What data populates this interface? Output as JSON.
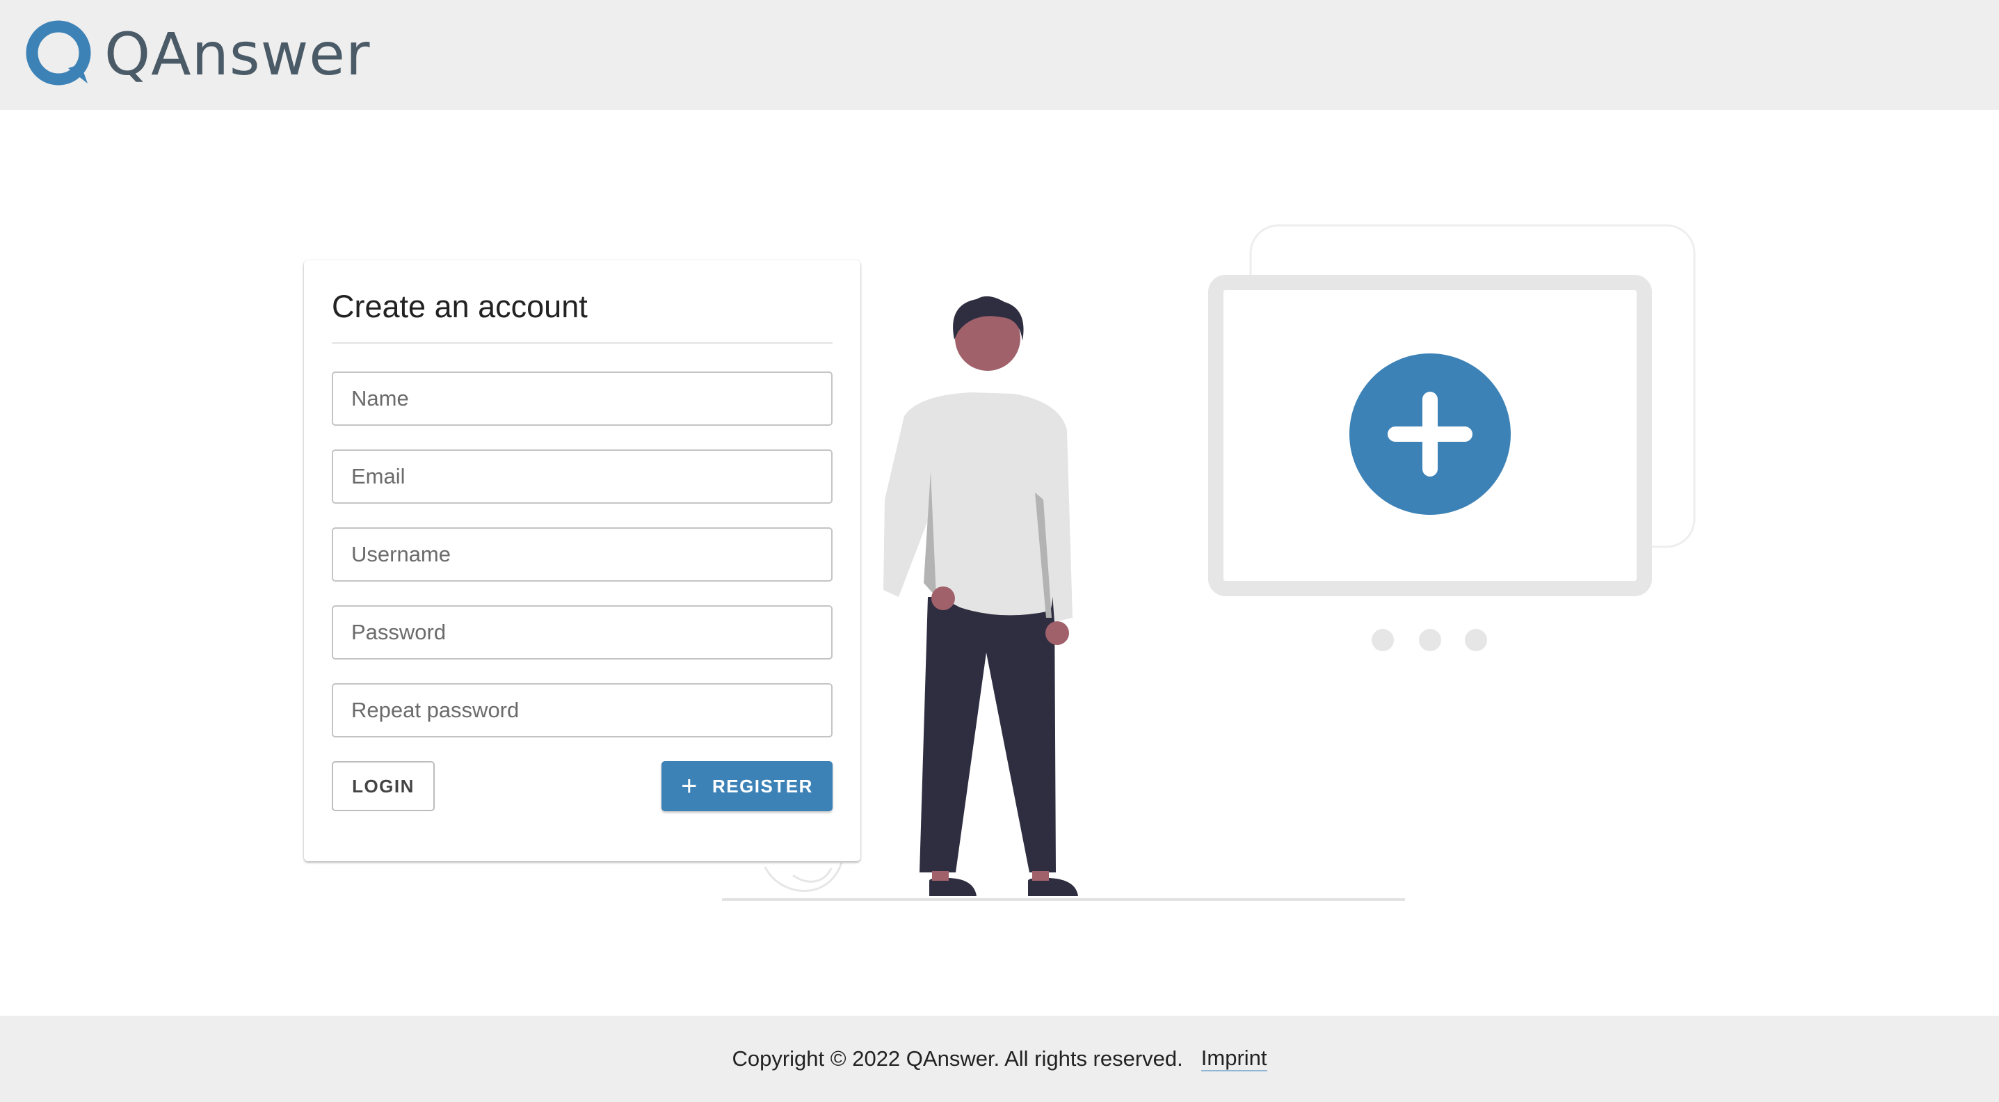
{
  "header": {
    "logo_text": "QAnswer",
    "brand_color": "#3d82b6",
    "icon": "qanswer-logo-icon"
  },
  "form": {
    "title": "Create an account",
    "fields": {
      "name_placeholder": "Name",
      "email_placeholder": "Email",
      "username_placeholder": "Username",
      "password_placeholder": "Password",
      "repeat_password_placeholder": "Repeat password"
    },
    "login_label": "LOGIN",
    "register_label": "REGISTER",
    "register_icon": "plus-icon"
  },
  "illustration": {
    "icon": "add-window-icon",
    "accent_color": "#3d82b6"
  },
  "footer": {
    "copyright": "Copyright © 2022 QAnswer. All rights reserved.",
    "imprint_label": "Imprint"
  }
}
